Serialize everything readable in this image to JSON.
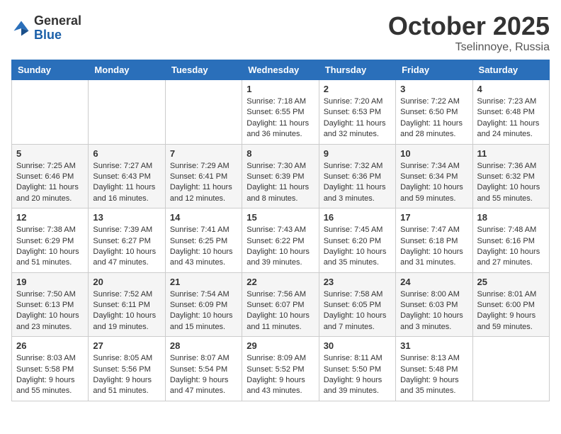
{
  "header": {
    "logo_general": "General",
    "logo_blue": "Blue",
    "month_title": "October 2025",
    "location": "Tselinnoye, Russia"
  },
  "weekdays": [
    "Sunday",
    "Monday",
    "Tuesday",
    "Wednesday",
    "Thursday",
    "Friday",
    "Saturday"
  ],
  "weeks": [
    [
      {
        "day": "",
        "info": ""
      },
      {
        "day": "",
        "info": ""
      },
      {
        "day": "",
        "info": ""
      },
      {
        "day": "1",
        "info": "Sunrise: 7:18 AM\nSunset: 6:55 PM\nDaylight: 11 hours and 36 minutes."
      },
      {
        "day": "2",
        "info": "Sunrise: 7:20 AM\nSunset: 6:53 PM\nDaylight: 11 hours and 32 minutes."
      },
      {
        "day": "3",
        "info": "Sunrise: 7:22 AM\nSunset: 6:50 PM\nDaylight: 11 hours and 28 minutes."
      },
      {
        "day": "4",
        "info": "Sunrise: 7:23 AM\nSunset: 6:48 PM\nDaylight: 11 hours and 24 minutes."
      }
    ],
    [
      {
        "day": "5",
        "info": "Sunrise: 7:25 AM\nSunset: 6:46 PM\nDaylight: 11 hours and 20 minutes."
      },
      {
        "day": "6",
        "info": "Sunrise: 7:27 AM\nSunset: 6:43 PM\nDaylight: 11 hours and 16 minutes."
      },
      {
        "day": "7",
        "info": "Sunrise: 7:29 AM\nSunset: 6:41 PM\nDaylight: 11 hours and 12 minutes."
      },
      {
        "day": "8",
        "info": "Sunrise: 7:30 AM\nSunset: 6:39 PM\nDaylight: 11 hours and 8 minutes."
      },
      {
        "day": "9",
        "info": "Sunrise: 7:32 AM\nSunset: 6:36 PM\nDaylight: 11 hours and 3 minutes."
      },
      {
        "day": "10",
        "info": "Sunrise: 7:34 AM\nSunset: 6:34 PM\nDaylight: 10 hours and 59 minutes."
      },
      {
        "day": "11",
        "info": "Sunrise: 7:36 AM\nSunset: 6:32 PM\nDaylight: 10 hours and 55 minutes."
      }
    ],
    [
      {
        "day": "12",
        "info": "Sunrise: 7:38 AM\nSunset: 6:29 PM\nDaylight: 10 hours and 51 minutes."
      },
      {
        "day": "13",
        "info": "Sunrise: 7:39 AM\nSunset: 6:27 PM\nDaylight: 10 hours and 47 minutes."
      },
      {
        "day": "14",
        "info": "Sunrise: 7:41 AM\nSunset: 6:25 PM\nDaylight: 10 hours and 43 minutes."
      },
      {
        "day": "15",
        "info": "Sunrise: 7:43 AM\nSunset: 6:22 PM\nDaylight: 10 hours and 39 minutes."
      },
      {
        "day": "16",
        "info": "Sunrise: 7:45 AM\nSunset: 6:20 PM\nDaylight: 10 hours and 35 minutes."
      },
      {
        "day": "17",
        "info": "Sunrise: 7:47 AM\nSunset: 6:18 PM\nDaylight: 10 hours and 31 minutes."
      },
      {
        "day": "18",
        "info": "Sunrise: 7:48 AM\nSunset: 6:16 PM\nDaylight: 10 hours and 27 minutes."
      }
    ],
    [
      {
        "day": "19",
        "info": "Sunrise: 7:50 AM\nSunset: 6:13 PM\nDaylight: 10 hours and 23 minutes."
      },
      {
        "day": "20",
        "info": "Sunrise: 7:52 AM\nSunset: 6:11 PM\nDaylight: 10 hours and 19 minutes."
      },
      {
        "day": "21",
        "info": "Sunrise: 7:54 AM\nSunset: 6:09 PM\nDaylight: 10 hours and 15 minutes."
      },
      {
        "day": "22",
        "info": "Sunrise: 7:56 AM\nSunset: 6:07 PM\nDaylight: 10 hours and 11 minutes."
      },
      {
        "day": "23",
        "info": "Sunrise: 7:58 AM\nSunset: 6:05 PM\nDaylight: 10 hours and 7 minutes."
      },
      {
        "day": "24",
        "info": "Sunrise: 8:00 AM\nSunset: 6:03 PM\nDaylight: 10 hours and 3 minutes."
      },
      {
        "day": "25",
        "info": "Sunrise: 8:01 AM\nSunset: 6:00 PM\nDaylight: 9 hours and 59 minutes."
      }
    ],
    [
      {
        "day": "26",
        "info": "Sunrise: 8:03 AM\nSunset: 5:58 PM\nDaylight: 9 hours and 55 minutes."
      },
      {
        "day": "27",
        "info": "Sunrise: 8:05 AM\nSunset: 5:56 PM\nDaylight: 9 hours and 51 minutes."
      },
      {
        "day": "28",
        "info": "Sunrise: 8:07 AM\nSunset: 5:54 PM\nDaylight: 9 hours and 47 minutes."
      },
      {
        "day": "29",
        "info": "Sunrise: 8:09 AM\nSunset: 5:52 PM\nDaylight: 9 hours and 43 minutes."
      },
      {
        "day": "30",
        "info": "Sunrise: 8:11 AM\nSunset: 5:50 PM\nDaylight: 9 hours and 39 minutes."
      },
      {
        "day": "31",
        "info": "Sunrise: 8:13 AM\nSunset: 5:48 PM\nDaylight: 9 hours and 35 minutes."
      },
      {
        "day": "",
        "info": ""
      }
    ]
  ]
}
